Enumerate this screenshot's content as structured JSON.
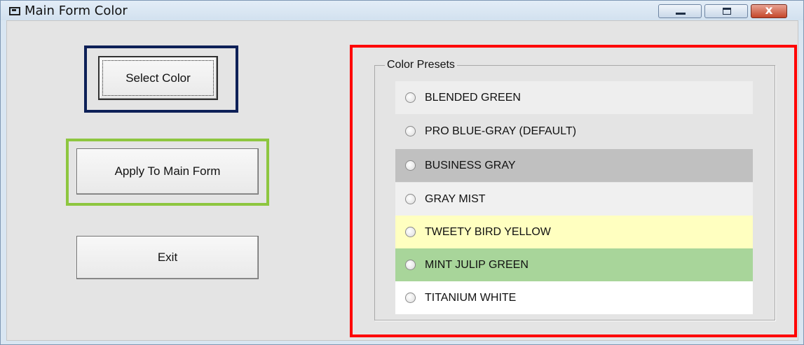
{
  "window": {
    "title": "Main Form Color",
    "controls": {
      "minimize": "minimize",
      "maximize": "maximize",
      "close": "x"
    }
  },
  "buttons": {
    "select_color": "Select Color",
    "apply_to_main_form": "Apply To Main Form",
    "exit": "Exit"
  },
  "highlight_colors": {
    "select_color_box": "#0d2057",
    "apply_box": "#8dc63f",
    "presets_box": "#ff0000"
  },
  "presets": {
    "legend": "Color Presets",
    "options": [
      {
        "label": "BLENDED GREEN",
        "bg": "#eeeeee"
      },
      {
        "label": "PRO BLUE-GRAY (DEFAULT)",
        "bg": "#e4e4e4"
      },
      {
        "label": "BUSINESS GRAY",
        "bg": "#c0c0c0"
      },
      {
        "label": "GRAY MIST",
        "bg": "#f0f0f0"
      },
      {
        "label": "TWEETY BIRD YELLOW",
        "bg": "#ffffc0"
      },
      {
        "label": "MINT JULIP GREEN",
        "bg": "#a8d59a"
      },
      {
        "label": "TITANIUM WHITE",
        "bg": "#ffffff"
      }
    ]
  }
}
